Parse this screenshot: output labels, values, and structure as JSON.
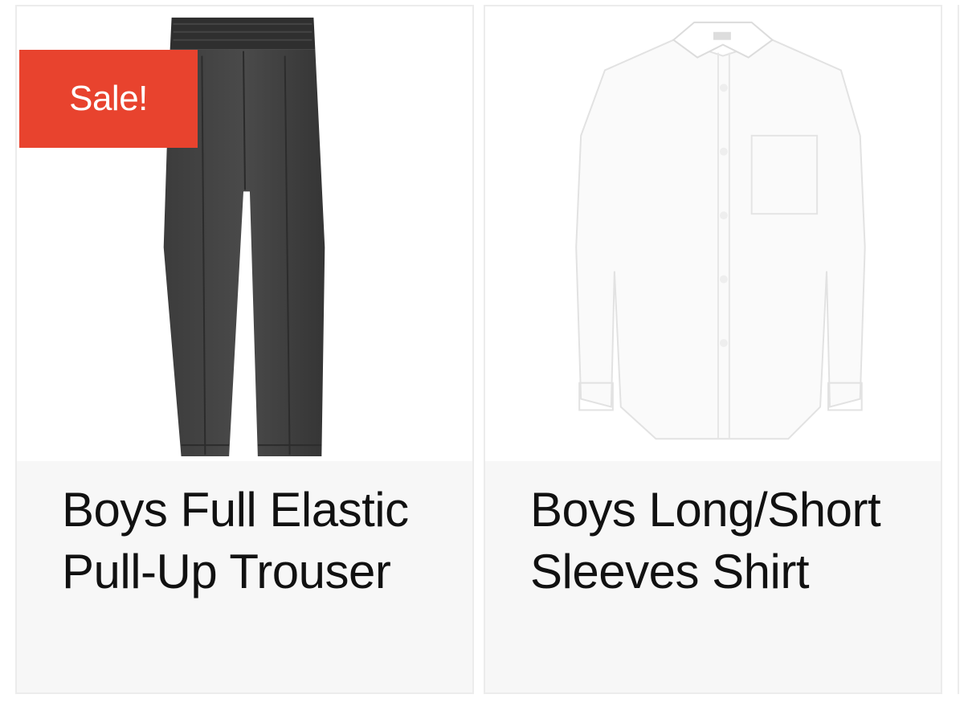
{
  "products": [
    {
      "title": "Boys Full Elastic Pull-Up Trouser",
      "badge": "Sale!",
      "image_icon": "grey-trousers-image"
    },
    {
      "title": "Boys Long/Short Sleeves Shirt",
      "image_icon": "white-shirt-image"
    }
  ],
  "colors": {
    "sale_badge": "#e8432e",
    "title_background": "#f7f7f7",
    "title_text": "#111111",
    "card_border": "#ececec"
  }
}
